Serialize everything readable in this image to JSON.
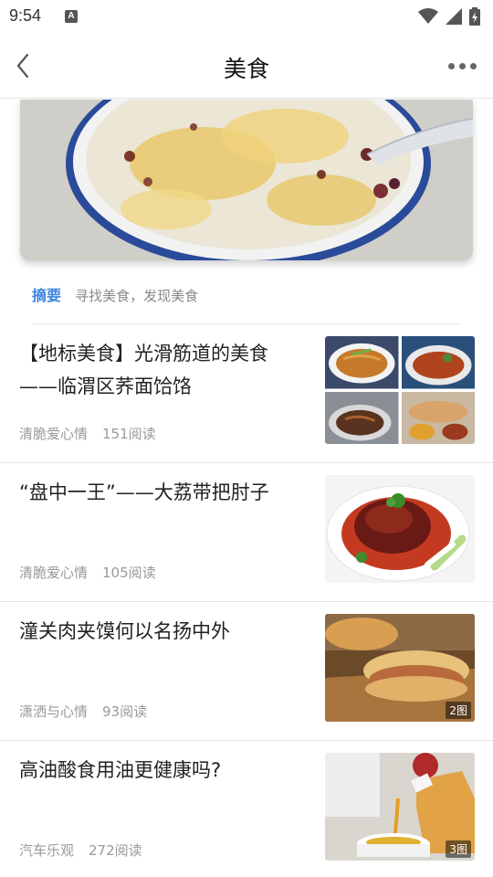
{
  "status_bar": {
    "time": "9:54",
    "notification_icon_letter": "A"
  },
  "header": {
    "title": "美食",
    "back_icon": "chevron-left-icon",
    "more_icon": "more-dots-icon"
  },
  "summary": {
    "label": "摘要",
    "text": "寻找美食，发现美食"
  },
  "articles": [
    {
      "title": "【地标美食】光滑筋道的美食——临渭区荞面饸饹",
      "author": "清脆爱心情",
      "reads": "151阅读",
      "thumb_type": "grid4"
    },
    {
      "title": "“盘中一王”——大荔带把肘子",
      "author": "清脆爱心情",
      "reads": "105阅读",
      "thumb_type": "single"
    },
    {
      "title": "潼关肉夹馍何以名扬中外",
      "author": "潇洒与心情",
      "reads": "93阅读",
      "thumb_type": "single",
      "badge": "2图"
    },
    {
      "title": "高油酸食用油更健康吗?",
      "author": "汽车乐观",
      "reads": "272阅读",
      "thumb_type": "single",
      "badge": "3图"
    }
  ],
  "colors": {
    "accent": "#3b86e0",
    "meta_text": "#999999",
    "divider": "#e4e4e4"
  }
}
